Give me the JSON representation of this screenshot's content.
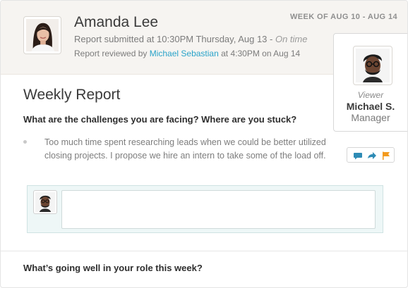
{
  "header": {
    "name": "Amanda Lee",
    "submitted_text": "Report submitted at 10:30PM Thursday, Aug 13 - ",
    "submitted_status": "On time",
    "reviewed_prefix": "Report reviewed by ",
    "reviewer": "Michael Sebastian",
    "reviewed_suffix": " at 4:30PM on Aug 14",
    "week_range": "WEEK OF AUG 10 - AUG 14"
  },
  "viewer": {
    "role": "Viewer",
    "name": "Michael S.",
    "title": "Manager"
  },
  "report": {
    "title": "Weekly Report",
    "questions": [
      {
        "question": "What are the challenges you are facing? Where are you stuck?",
        "answer": "Too much time spent researching leads when we could be better utilized closing projects. I propose we hire an intern to take some of the load off."
      },
      {
        "question": "What’s going well in your role this week?"
      }
    ],
    "actions": {
      "comment_icon": "comment-icon",
      "share_icon": "share-icon",
      "flag_icon": "flag-icon"
    },
    "comment": {
      "value": "",
      "placeholder": ""
    }
  },
  "colors": {
    "link": "#2aa3c9",
    "flag": "#f39a1e",
    "action": "#2e8bb5",
    "header_bg": "#f6f4f1",
    "comment_bg": "#eef7f7"
  }
}
